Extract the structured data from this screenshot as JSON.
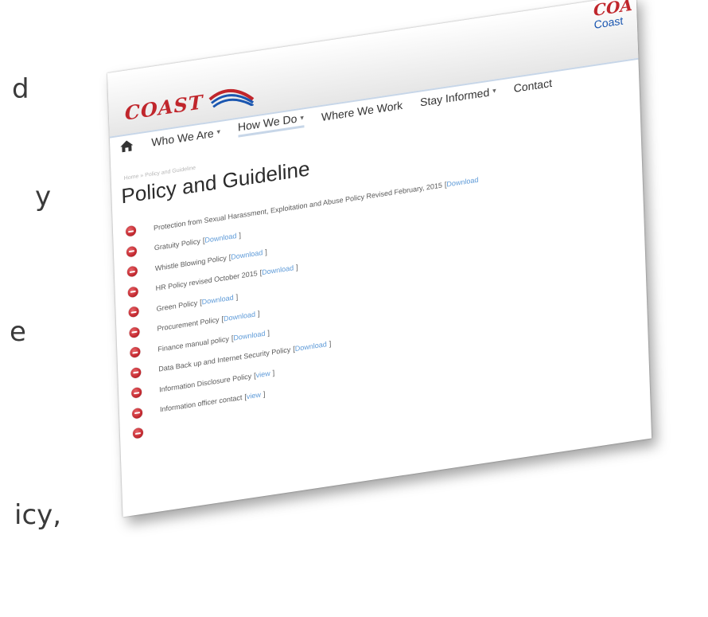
{
  "background_fragments": [
    "d",
    "y",
    "e",
    "icy,"
  ],
  "brand": {
    "logo_text": "COAST",
    "right_line1": "COA",
    "right_line2": "Coast",
    "primary_color": "#c0262c",
    "secondary_color": "#1a56b0"
  },
  "nav": {
    "items": [
      {
        "label": "Who We Are",
        "dropdown": true
      },
      {
        "label": "How We Do",
        "dropdown": true
      },
      {
        "label": "Where We Work",
        "dropdown": false
      },
      {
        "label": "Stay Informed",
        "dropdown": true
      },
      {
        "label": "Contact",
        "dropdown": false
      }
    ]
  },
  "breadcrumb": "Home » Policy and Guideline",
  "page_title": "Policy and Guideline",
  "policies": [
    {
      "label": "Protection from Sexual Harassment, Exploitation and Abuse Policy Revised February, 2015",
      "link": "Download",
      "bracketed": true
    },
    {
      "label": "Gratuity Policy",
      "link": "Download",
      "bracketed": true
    },
    {
      "label": "Whistle Blowing Policy",
      "link": "Download",
      "bracketed": true
    },
    {
      "label": "HR Policy revised October 2015",
      "link": "Download",
      "bracketed": true
    },
    {
      "label": "Green Policy",
      "link": "Download",
      "bracketed": true
    },
    {
      "label": "Procurement Policy",
      "link": "Download",
      "bracketed": true
    },
    {
      "label": "Finance manual policy",
      "link": "Download",
      "bracketed": true
    },
    {
      "label": "Data Back up and Internet Security Policy",
      "link": "Download",
      "bracketed": true
    },
    {
      "label": "Information Disclosure Policy",
      "link": "view",
      "bracketed": true
    },
    {
      "label": "Information officer contact",
      "link": "view",
      "bracketed": true
    }
  ],
  "icons": {
    "home": "home-icon",
    "bullet": "minus-circle-icon",
    "caret": "chevron-down-icon"
  },
  "colors": {
    "link": "#5d9ad8",
    "bullet": "#c42a31"
  }
}
